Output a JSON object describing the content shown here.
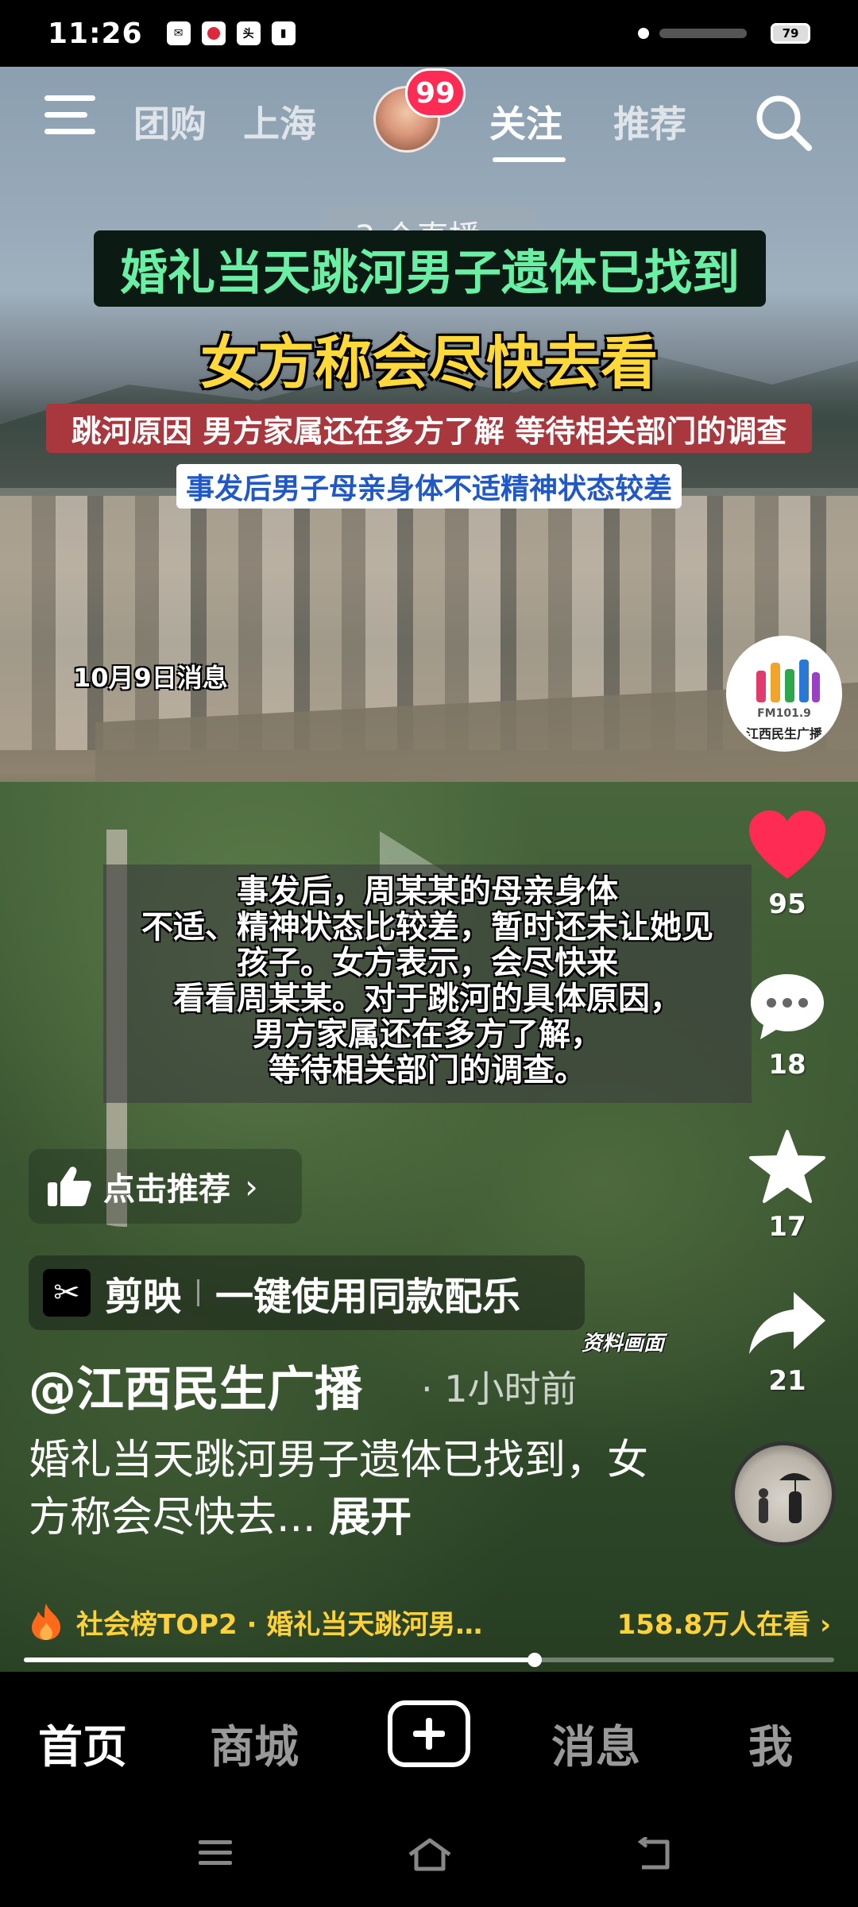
{
  "status_bar": {
    "time": "11:26",
    "notification_icons": [
      "mail-icon",
      "video-app-icon",
      "toutiao-icon",
      "book-icon"
    ],
    "battery": "79"
  },
  "top_nav": {
    "tabs": [
      {
        "label": "团购",
        "active": false
      },
      {
        "label": "上海",
        "active": false
      },
      {
        "label": "关注",
        "active": true
      },
      {
        "label": "推荐",
        "active": false
      }
    ],
    "follow_badge": "99"
  },
  "live_pill": "3 个直播 ›",
  "headlines": {
    "line1": "婚礼当天跳河男子遗体已找到",
    "line2": "女方称会尽快去看",
    "line3": "跳河原因 男方家属还在多方了解 等待相关部门的调查",
    "line4": "事发后男子母亲身体不适精神状态较差"
  },
  "date_label": "10月9日消息",
  "caption_lines": [
    "事发后，周某某的母亲身体",
    "不适、精神状态比较差，暂时还未让她见",
    "孩子。女方表示，会尽快来",
    "看看周某某。对于跳河的具体原因，",
    "男方家属还在多方了解，",
    "等待相关部门的调查。"
  ],
  "channel_logo": {
    "fm": "FM101.9",
    "name": "江西民生广播"
  },
  "rail": {
    "likes": "95",
    "comments": "18",
    "favorites": "17",
    "shares": "21"
  },
  "recommend_chip": "点击推荐",
  "capcut": {
    "name": "剪映",
    "text": "一键使用同款配乐"
  },
  "watermark": "资料画面",
  "author": "@江西民生广播",
  "post_time": "· 1小时前",
  "description": "婚礼当天跳河男子遗体已找到，女方称会尽快去...",
  "description_more": "展开",
  "hot": {
    "text": "社会榜TOP2 · 婚礼当天跳河男…",
    "views": "158.8万人在看 ›"
  },
  "progress": 0.63,
  "bottom_tabs": [
    {
      "label": "首页",
      "active": true
    },
    {
      "label": "商城",
      "active": false
    },
    {
      "label": "消息",
      "active": false
    },
    {
      "label": "我",
      "active": false
    }
  ],
  "colors": {
    "like_red": "#fe2c55",
    "headline_green": "#6af0a4",
    "headline_yellow": "#ffd93a",
    "hot_yellow": "#ffd23a"
  }
}
